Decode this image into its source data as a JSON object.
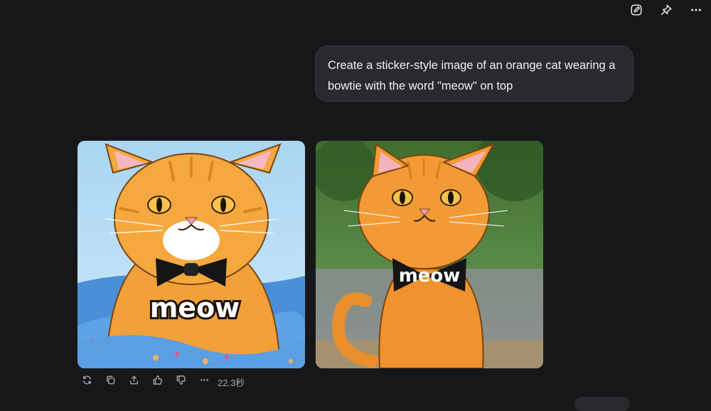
{
  "toolbar": {
    "icons": [
      "edit-icon",
      "pin-icon",
      "more-icon"
    ]
  },
  "conversation": {
    "user_message": "Create a sticker-style image of an orange cat wearing a bowtie with the word \"meow\" on top",
    "images": [
      {
        "caption_text": "meow",
        "background": "blue sky and blue floral blanket"
      },
      {
        "caption_text": "meow",
        "background": "green garden street"
      }
    ],
    "actions": {
      "icons": [
        "regenerate-icon",
        "copy-icon",
        "share-icon",
        "thumbs-up-icon",
        "thumbs-down-icon",
        "more-icon"
      ],
      "elapsed": "22.3秒"
    }
  },
  "colors": {
    "background": "#17171a",
    "bubble": "#2a2a2e",
    "cat_orange": "#f2a03a",
    "text_muted": "#a4a4aa"
  }
}
